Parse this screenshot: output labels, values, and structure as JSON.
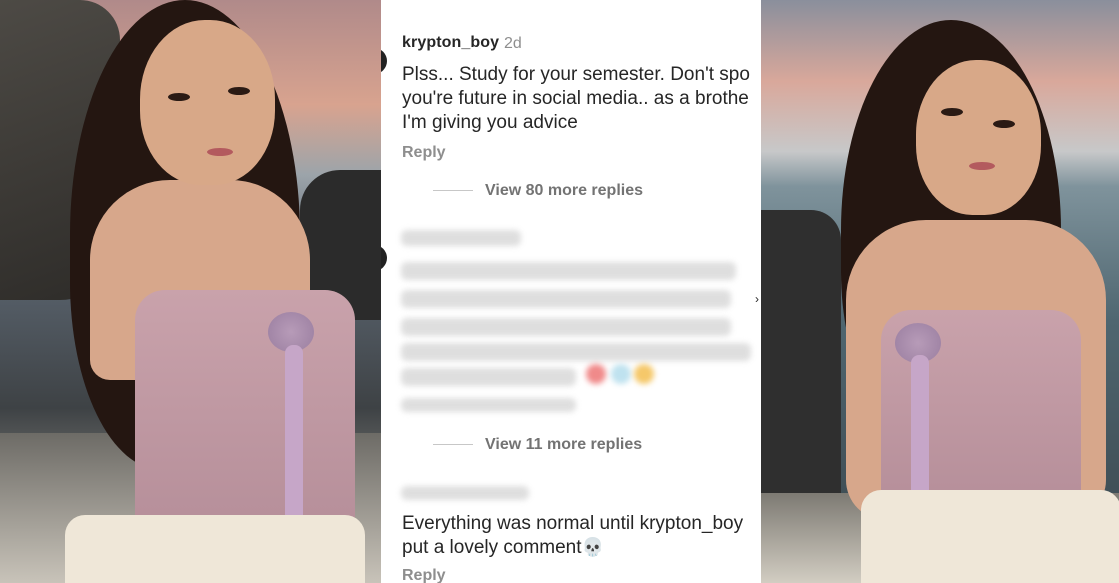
{
  "comments": [
    {
      "username": "krypton_boy",
      "time": "2d",
      "lines": [
        "Plss... Study for your semester. Don't spo",
        "you're future in social media.. as a brothe",
        "I'm giving you advice"
      ],
      "reply_label": "Reply",
      "view_more_label": "View 80 more replies"
    },
    {
      "view_more_label": "View 11 more replies"
    },
    {
      "lines": [
        "Everything was normal until krypton_boy",
        "put a lovely comment"
      ],
      "emoji": "💀",
      "reply_label": "Reply"
    }
  ],
  "icons": {
    "skull": "skull-emoji",
    "chevron": "chevron-right-icon"
  },
  "colors": {
    "username": "#262626",
    "muted": "#8e8e8e",
    "background": "#ffffff"
  }
}
